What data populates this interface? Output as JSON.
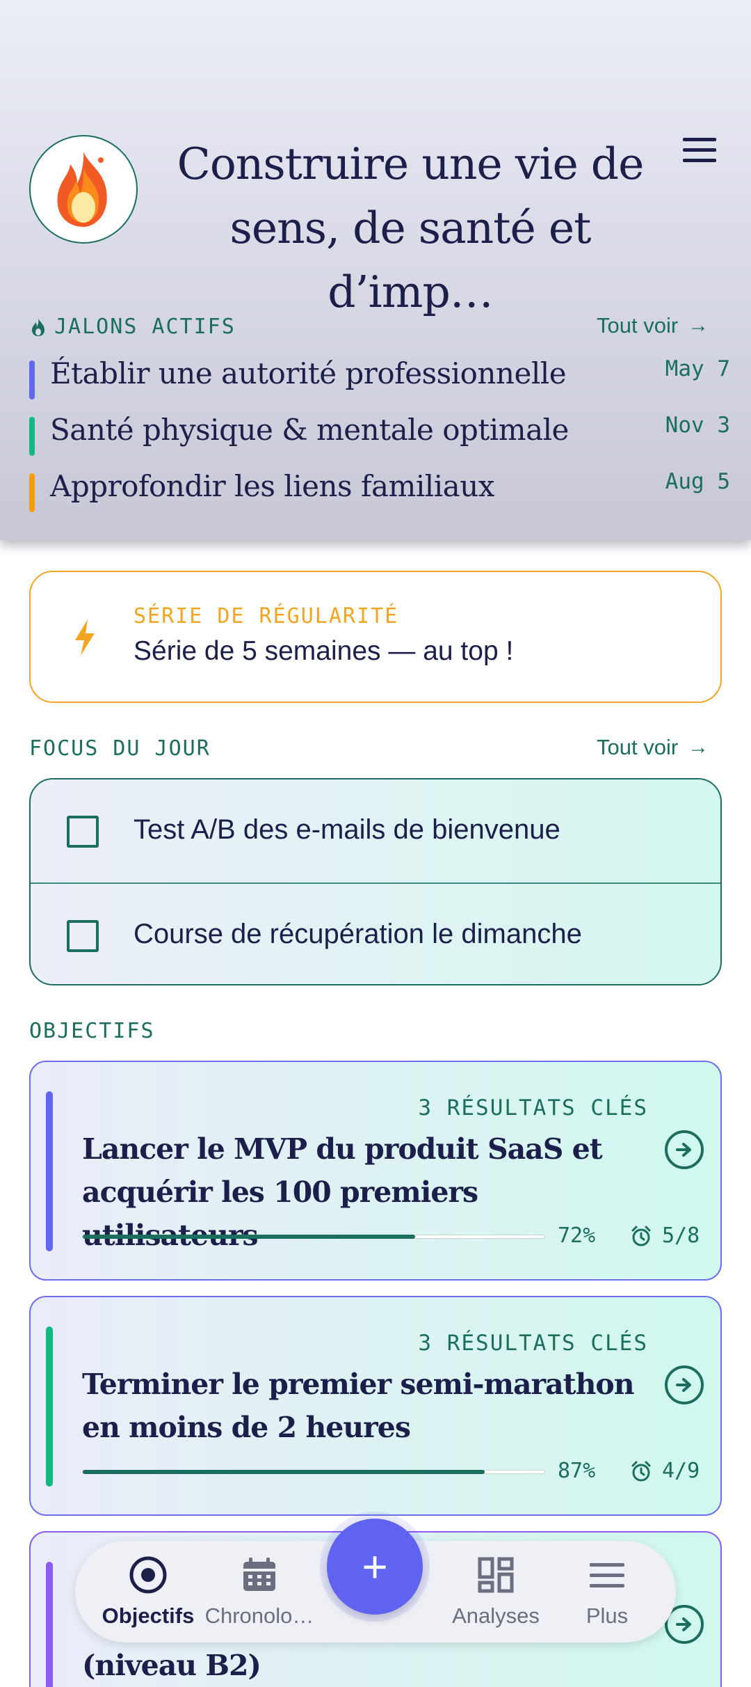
{
  "header": {
    "title": "Construire une vie de sens, de santé et d’imp…",
    "avatar_icon": "flame-icon",
    "menu_icon": "menu-icon"
  },
  "milestones": {
    "section_label": "JALONS ACTIFS",
    "see_all": "Tout voir",
    "items": [
      {
        "name": "Établir une autorité professionnelle",
        "date": "May 7",
        "color": "#6366f1"
      },
      {
        "name": "Santé physique & mentale optimale",
        "date": "Nov 3",
        "color": "#10b981"
      },
      {
        "name": "Approfondir les liens familiaux",
        "date": "Aug 5",
        "color": "#f59e0b"
      }
    ]
  },
  "streak": {
    "kicker": "SÉRIE DE RÉGULARITÉ",
    "text": "Série de 5 semaines — au top !",
    "icon": "bolt-icon"
  },
  "focus": {
    "section_label": "FOCUS DU JOUR",
    "see_all": "Tout voir",
    "items": [
      {
        "label": "Test A/B des e-mails de bienvenue",
        "checked": false
      },
      {
        "label": "Course de récupération le dimanche",
        "checked": false
      }
    ]
  },
  "objectives": {
    "section_label": "OBJECTIFS",
    "items": [
      {
        "key_results": "3 RÉSULTATS CLÉS",
        "name": "Lancer le MVP du produit SaaS et acquérir les 100 premiers utilisateurs",
        "progress": 0.72,
        "progress_label": "72%",
        "count": "5/8",
        "color": "#6366f1"
      },
      {
        "key_results": "3 RÉSULTATS CLÉS",
        "name": "Terminer le premier semi-marathon en moins de 2 heures",
        "progress": 0.87,
        "progress_label": "87%",
        "count": "4/9",
        "color": "#10b981"
      },
      {
        "key_results": "",
        "name": "(niveau B2)",
        "color": "#8b5cf6"
      }
    ]
  },
  "nav": {
    "items": [
      {
        "label": "Objectifs",
        "icon": "target-icon",
        "active": true
      },
      {
        "label": "Chronolo…",
        "icon": "calendar-icon",
        "active": false
      },
      {
        "label": "Analyses",
        "icon": "dashboard-icon",
        "active": false
      },
      {
        "label": "Plus",
        "icon": "menu-icon",
        "active": false
      }
    ],
    "fab_label": "+"
  }
}
